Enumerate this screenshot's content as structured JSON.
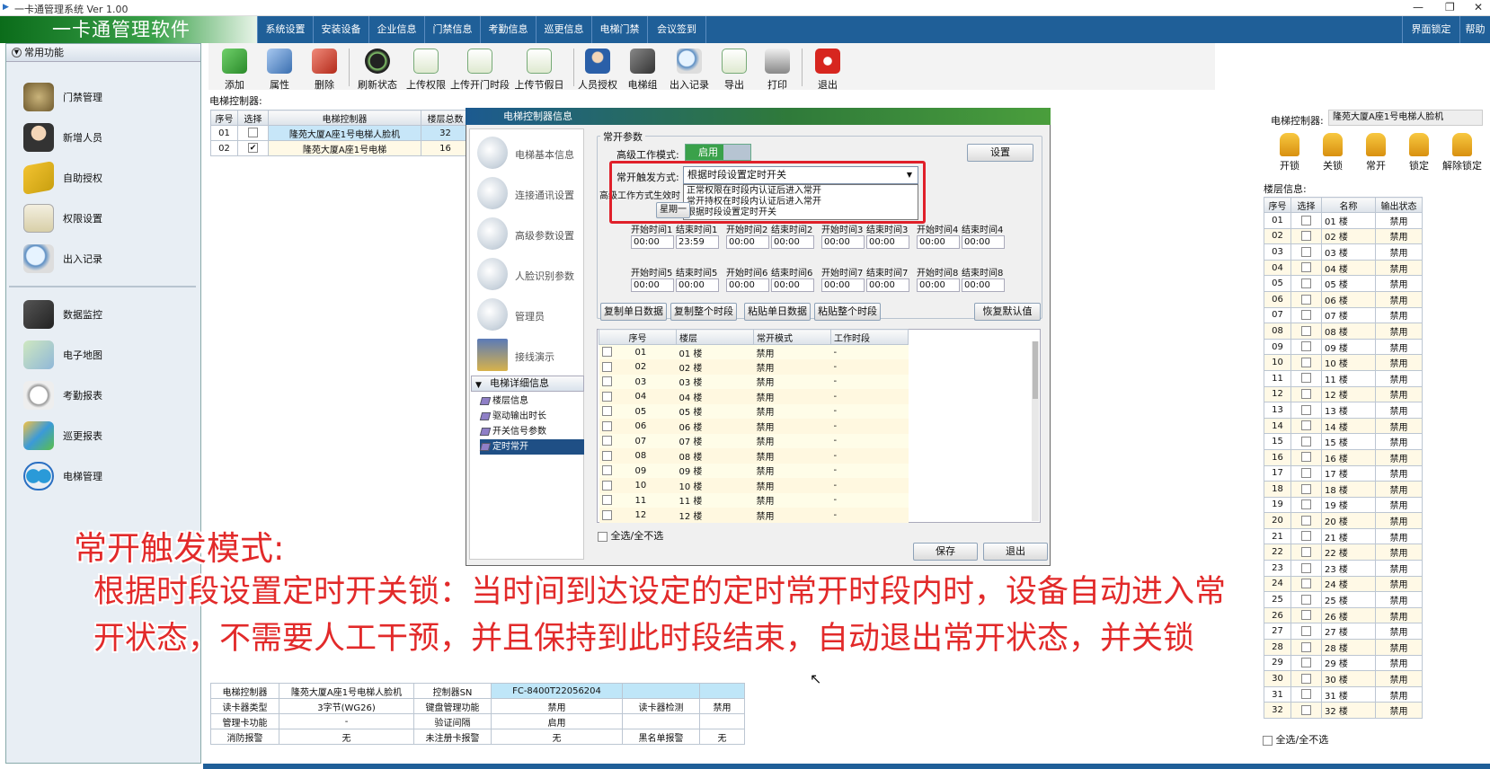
{
  "window": {
    "title": "一卡通管理系统  Ver 1.00",
    "controls": [
      "—",
      "❐",
      "✕"
    ]
  },
  "app": {
    "logo": "一卡通管理软件"
  },
  "menu": {
    "items": [
      "系统设置",
      "安装设备",
      "企业信息",
      "门禁信息",
      "考勤信息",
      "巡更信息",
      "电梯门禁",
      "会议签到"
    ],
    "lock": "界面锁定",
    "help": "帮助"
  },
  "sidebar": {
    "header": "常用功能",
    "items": [
      "门禁管理",
      "新增人员",
      "自助授权",
      "权限设置",
      "出入记录",
      "数据监控",
      "电子地图",
      "考勤报表",
      "巡更报表",
      "电梯管理"
    ]
  },
  "toolbar": {
    "buttons": [
      "添加",
      "属性",
      "删除",
      "刷新状态",
      "上传权限",
      "上传开门时段",
      "上传节假日",
      "人员授权",
      "电梯组",
      "出入记录",
      "导出",
      "打印",
      "退出"
    ]
  },
  "controllers": {
    "label": "电梯控制器:",
    "headers": [
      "序号",
      "选择",
      "电梯控制器",
      "楼层总数"
    ],
    "rows": [
      {
        "no": "01",
        "name": "隆苑大厦A座1号电梯人脸机",
        "floors": "32"
      },
      {
        "no": "02",
        "name": "隆苑大厦A座1号电梯",
        "floors": "16"
      }
    ]
  },
  "dialog": {
    "title": "电梯控制器信息",
    "nav": [
      "电梯基本信息",
      "连接通讯设置",
      "高级参数设置",
      "人脸识别参数",
      "管理员",
      "接线演示"
    ],
    "tree": {
      "header": "电梯详细信息",
      "nodes": [
        "楼层信息",
        "驱动输出时长",
        "开关信号参数",
        "定时常开"
      ]
    },
    "group_title": "常开参数",
    "adv_mode_label": "高级工作模式:",
    "adv_mode_value": "启用",
    "setting_button": "设置",
    "trigger_label": "常开触发方式:",
    "trigger_value": "根据时段设置定时开关",
    "trigger_options": [
      "正常权限在时段内认证后进入常开",
      "常开持权在时段内认证后进入常开",
      "根据时段设置定时开关"
    ],
    "adv_effect_label": "高级工作方式生效时",
    "weekday_tab": "星期一",
    "time_labels_row1": [
      "开始时间1",
      "结束时间1",
      "开始时间2",
      "结束时间2",
      "开始时间3",
      "结束时间3",
      "开始时间4",
      "结束时间4"
    ],
    "time_values_row1": [
      "00:00",
      "23:59",
      "00:00",
      "00:00",
      "00:00",
      "00:00",
      "00:00",
      "00:00"
    ],
    "time_labels_row2": [
      "开始时间5",
      "结束时间5",
      "开始时间6",
      "结束时间6",
      "开始时间7",
      "结束时间7",
      "开始时间8",
      "结束时间8"
    ],
    "time_values_row2": [
      "00:00",
      "00:00",
      "00:00",
      "00:00",
      "00:00",
      "00:00",
      "00:00",
      "00:00"
    ],
    "action_buttons": [
      "复制单日数据",
      "复制整个时段",
      "粘贴单日数据",
      "粘贴整个时段"
    ],
    "restore_button": "恢复默认值",
    "list_headers": [
      "序号",
      "楼层",
      "常开模式",
      "工作时段"
    ],
    "list_rows": [
      [
        "01",
        "01 楼",
        "禁用",
        "-"
      ],
      [
        "02",
        "02 楼",
        "禁用",
        "-"
      ],
      [
        "03",
        "03 楼",
        "禁用",
        "-"
      ],
      [
        "04",
        "04 楼",
        "禁用",
        "-"
      ],
      [
        "05",
        "05 楼",
        "禁用",
        "-"
      ],
      [
        "06",
        "06 楼",
        "禁用",
        "-"
      ],
      [
        "07",
        "07 楼",
        "禁用",
        "-"
      ],
      [
        "08",
        "08 楼",
        "禁用",
        "-"
      ],
      [
        "09",
        "09 楼",
        "禁用",
        "-"
      ],
      [
        "10",
        "10 楼",
        "禁用",
        "-"
      ],
      [
        "11",
        "11 楼",
        "禁用",
        "-"
      ],
      [
        "12",
        "12 楼",
        "禁用",
        "-"
      ]
    ],
    "select_all": "全选/全不选",
    "save": "保存",
    "exit": "退出"
  },
  "right_panel": {
    "controller_label": "电梯控制器:",
    "controller_value": "隆苑大厦A座1号电梯人脸机",
    "lock_buttons": [
      "开锁",
      "关锁",
      "常开",
      "锁定",
      "解除锁定"
    ],
    "floor_info_label": "楼层信息:",
    "headers": [
      "序号",
      "选择",
      "名称",
      "输出状态"
    ],
    "rows": [
      [
        "01",
        "01 楼",
        "禁用"
      ],
      [
        "02",
        "02 楼",
        "禁用"
      ],
      [
        "03",
        "03 楼",
        "禁用"
      ],
      [
        "04",
        "04 楼",
        "禁用"
      ],
      [
        "05",
        "05 楼",
        "禁用"
      ],
      [
        "06",
        "06 楼",
        "禁用"
      ],
      [
        "07",
        "07 楼",
        "禁用"
      ],
      [
        "08",
        "08 楼",
        "禁用"
      ],
      [
        "09",
        "09 楼",
        "禁用"
      ],
      [
        "10",
        "10 楼",
        "禁用"
      ],
      [
        "11",
        "11 楼",
        "禁用"
      ],
      [
        "12",
        "12 楼",
        "禁用"
      ],
      [
        "13",
        "13 楼",
        "禁用"
      ],
      [
        "14",
        "14 楼",
        "禁用"
      ],
      [
        "15",
        "15 楼",
        "禁用"
      ],
      [
        "16",
        "16 楼",
        "禁用"
      ],
      [
        "17",
        "17 楼",
        "禁用"
      ],
      [
        "18",
        "18 楼",
        "禁用"
      ],
      [
        "19",
        "19 楼",
        "禁用"
      ],
      [
        "20",
        "20 楼",
        "禁用"
      ],
      [
        "21",
        "21 楼",
        "禁用"
      ],
      [
        "22",
        "22 楼",
        "禁用"
      ],
      [
        "23",
        "23 楼",
        "禁用"
      ],
      [
        "24",
        "24 楼",
        "禁用"
      ],
      [
        "25",
        "25 楼",
        "禁用"
      ],
      [
        "26",
        "26 楼",
        "禁用"
      ],
      [
        "27",
        "27 楼",
        "禁用"
      ],
      [
        "28",
        "28 楼",
        "禁用"
      ],
      [
        "29",
        "29 楼",
        "禁用"
      ],
      [
        "30",
        "30 楼",
        "禁用"
      ],
      [
        "31",
        "31 楼",
        "禁用"
      ],
      [
        "32",
        "32 楼",
        "禁用"
      ]
    ],
    "select_all": "全选/全不选"
  },
  "info_panel": {
    "rows": [
      [
        "电梯控制器",
        "隆苑大厦A座1号电梯人脸机",
        "控制器SN",
        "FC-8400T22056204",
        "",
        ""
      ],
      [
        "读卡器类型",
        "3字节(WG26)",
        "键盘管理功能",
        "禁用",
        "读卡器检测",
        "禁用"
      ],
      [
        "管理卡功能",
        "-",
        "验证间隔",
        "启用",
        "",
        ""
      ],
      [
        "消防报警",
        "无",
        "未注册卡报警",
        "无",
        "黑名单报警",
        "无"
      ]
    ]
  },
  "overlay": {
    "line1": "常开触发模式:",
    "line2": "根据时段设置定时开关锁：当时间到达设定的定时常开时段内时，设备自动进入常",
    "line3": "开状态，不需要人工干预，并且保持到此时段结束，自动退出常开状态，并关锁"
  },
  "colors": {
    "menubar": "#1f5f98",
    "annotation": "#e22a2a",
    "highlight_box": "#e0202a",
    "selected_tree": "#1f4f85"
  }
}
